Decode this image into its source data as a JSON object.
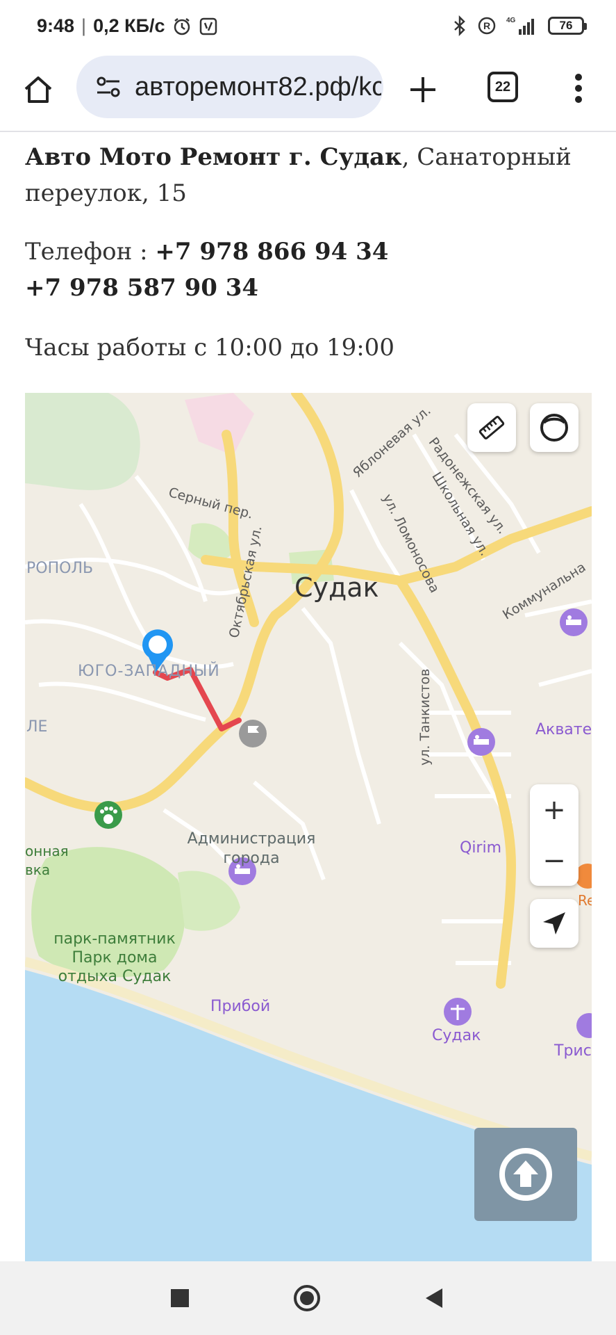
{
  "status_bar": {
    "time": "9:48",
    "speed": "0,2 КБ/с",
    "network": "4G",
    "battery": "76"
  },
  "browser": {
    "url": "авторемонт82.рф/kc",
    "tab_count": "22",
    "icons": {
      "home": "home-icon",
      "site_settings": "tune-icon",
      "new_tab": "plus-icon",
      "tabs": "tab-switcher-icon",
      "menu": "more-vert-icon"
    }
  },
  "page": {
    "name": "Авто Мото Ремонт г. Судак",
    "address_rest": ", Санаторный переулок, 15",
    "phone_label": "Телефон : ",
    "phone1": "+7 978 866 94 34",
    "phone2": "+7 978 587 90 34",
    "hours": "Часы работы с 10:00 до 19:00"
  },
  "map": {
    "colors": {
      "land": "#f1ede4",
      "sea": "#b5dcf3",
      "road": "#f7d97a",
      "route": "#e4474f",
      "marker": "#2196f3",
      "park": "#cfe8b4"
    },
    "city": "Судак",
    "district": "ЮГО-ЗАПАДНЫЙ",
    "edge_top_left": "РОПОЛЬ",
    "edge_left": "ЛЕ",
    "streets": {
      "serny": "Серный пер.",
      "oktyabrskaya": "Октябрьская ул.",
      "yablonevaya": "Яблоневая ул.",
      "radonezhskaya": "Радонежская ул.",
      "shkolnaya": "Школьная ул.",
      "lomonosova": "ул. Ломоносова",
      "kommunalnaya": "Коммунальна",
      "tankistov": "ул. Танкистов"
    },
    "pois": {
      "admin": "Администрация города",
      "park": "парк-памятник Парк дома отдыха Судак",
      "priboy": "Прибой",
      "qirim": "Qirim",
      "sudak_beach": "Судак",
      "akvatex": "Акватех",
      "tris": "Трис",
      "edge_poi": "онная вка",
      "re": "Re"
    },
    "controls": {
      "ruler": "ruler-icon",
      "layers": "layers-icon",
      "zoom_in": "+",
      "zoom_out": "−",
      "locate": "location-arrow-icon",
      "scroll_up": "arrow-up-icon"
    }
  },
  "nav_bar": {
    "recent": "square-icon",
    "home": "circle-icon",
    "back": "triangle-back-icon"
  }
}
